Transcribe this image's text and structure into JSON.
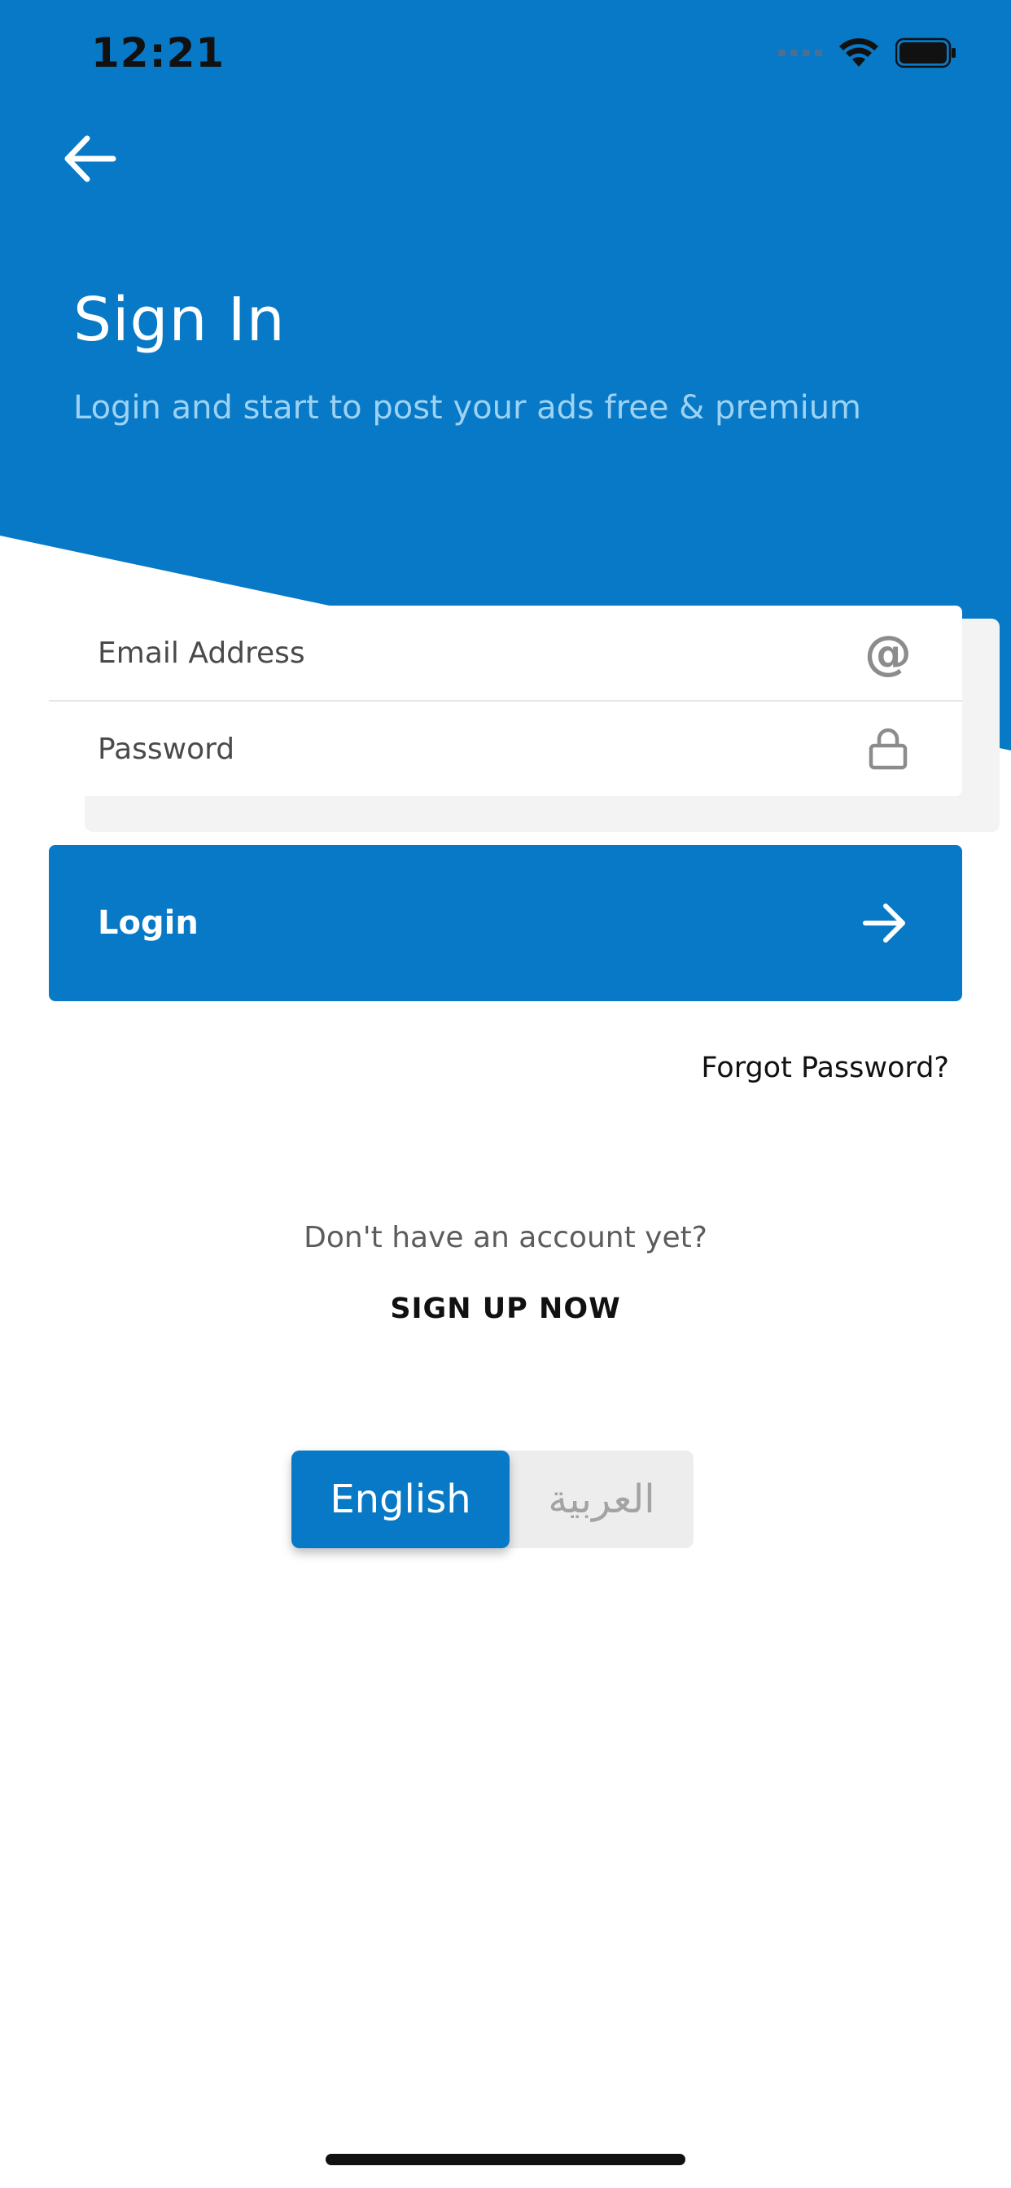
{
  "status_bar": {
    "time": "12:21"
  },
  "header": {
    "title": "Sign In",
    "subtitle": "Login and start to post your ads free & premium",
    "back_icon": "arrow-left-icon"
  },
  "form": {
    "email": {
      "placeholder": "Email Address",
      "value": "",
      "icon": "at-sign-icon",
      "icon_glyph": "@"
    },
    "password": {
      "placeholder": "Password",
      "value": "",
      "icon": "lock-icon"
    }
  },
  "login_button": {
    "label": "Login",
    "icon": "arrow-right-icon"
  },
  "forgot_password_label": "Forgot Password?",
  "signup": {
    "prompt": "Don't have an account yet?",
    "link_label": "SIGN UP NOW"
  },
  "language_switch": {
    "options": [
      "English",
      "العربية"
    ],
    "selected": "English"
  },
  "colors": {
    "primary": "#0779c7",
    "subtitle": "#9ed2f2",
    "switch_bg": "#ededed"
  }
}
